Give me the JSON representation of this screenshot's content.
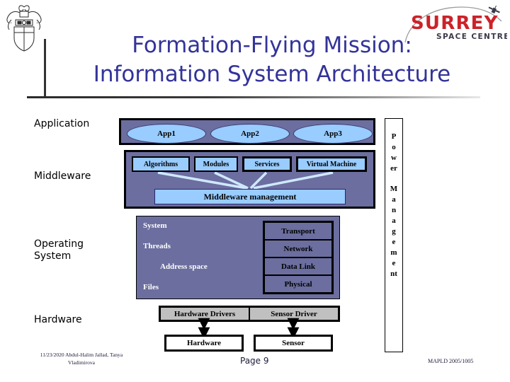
{
  "slide": {
    "title_line1": "Formation-Flying Mission:",
    "title_line2": "Information System Architecture",
    "title_color": "#333399"
  },
  "logo": {
    "brand": "SURREY",
    "subtitle": "SPACE CENTRE",
    "brand_color": "#cc2229",
    "subtitle_color": "#3a3a4a",
    "crest_alt": "university-crest"
  },
  "stack_labels": {
    "application": "Application",
    "middleware": "Middleware",
    "operating_system": "Operating\nSystem",
    "hardware": "Hardware"
  },
  "application_layer": {
    "apps": [
      "App1",
      "App2",
      "App3"
    ],
    "fill": "#6b6e9e",
    "node_fill": "#99ccff"
  },
  "middleware_layer": {
    "boxes": [
      "Algorithms",
      "Modules",
      "Services",
      "Virtual Machine"
    ],
    "management": "Middleware management",
    "fill": "#6b6e9e",
    "node_fill": "#99ccff"
  },
  "operating_system_layer": {
    "left_items": [
      "System",
      "Threads",
      "Address space",
      "Files"
    ],
    "protocol_stack": [
      "Transport",
      "Network",
      "Data Link",
      "Physical"
    ],
    "fill": "#6b6e9e",
    "text_color": "#ffffff"
  },
  "hardware_layer": {
    "drivers": [
      "Hardware Drivers",
      "Sensor Driver"
    ],
    "devices": [
      "Hardware",
      "Sensor"
    ],
    "driver_fill": "#c0c0c0",
    "device_fill": "#ffffff"
  },
  "power_management": {
    "label_part1": "Power",
    "label_part2": "Management",
    "chars1": [
      "P",
      "o",
      "w",
      "er"
    ],
    "chars2": [
      "M",
      "a",
      "n",
      "a",
      "g",
      "e",
      "m",
      "e",
      "nt"
    ]
  },
  "footer": {
    "date_authors": "11/23/2020  Abdul-Halim Jallad,\nTanya Vladimirova",
    "page": "Page 9",
    "conference": "MAPLD 2005/1005"
  }
}
